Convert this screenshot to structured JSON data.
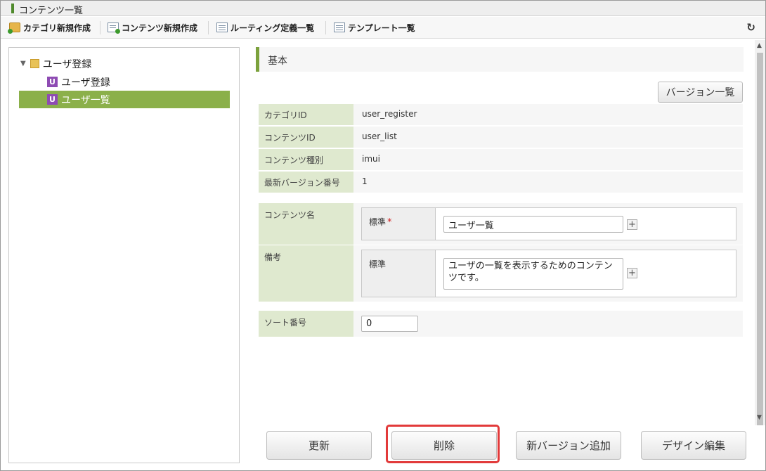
{
  "window": {
    "title": "コンテンツ一覧"
  },
  "toolbar": {
    "new_category": "カテゴリ新規作成",
    "new_content": "コンテンツ新規作成",
    "routing_list": "ルーティング定義一覧",
    "template_list": "テンプレート一覧",
    "refresh_icon": "↻"
  },
  "tree": {
    "folder_label": "ユーザ登録",
    "items": [
      {
        "icon": "U",
        "label": "ユーザ登録"
      },
      {
        "icon": "U",
        "label": "ユーザ一覧"
      }
    ],
    "toggle_glyph": "▼"
  },
  "section": {
    "title": "基本"
  },
  "version_list_button": "バージョン一覧",
  "info": [
    {
      "label": "カテゴリID",
      "value": "user_register"
    },
    {
      "label": "コンテンツID",
      "value": "user_list"
    },
    {
      "label": "コンテンツ種別",
      "value": "imui"
    },
    {
      "label": "最新バージョン番号",
      "value": "1"
    }
  ],
  "form": {
    "content_name": {
      "label": "コンテンツ名",
      "lang_label": "標準",
      "required_mark": "*",
      "value": "ユーザ一覧"
    },
    "remarks": {
      "label": "備考",
      "lang_label": "標準",
      "value": "ユーザの一覧を表示するためのコンテンツです。"
    },
    "sort_order": {
      "label": "ソート番号",
      "value": "0"
    },
    "plus_glyph": "+"
  },
  "actions": {
    "update": "更新",
    "delete": "削除",
    "add_version": "新バージョン追加",
    "design_edit": "デザイン編集"
  },
  "colors": {
    "accent_green": "#8bb04a",
    "label_bg": "#dfe9cf",
    "highlight_red": "#e23a3a",
    "u_icon_purple": "#8e4bb3"
  }
}
